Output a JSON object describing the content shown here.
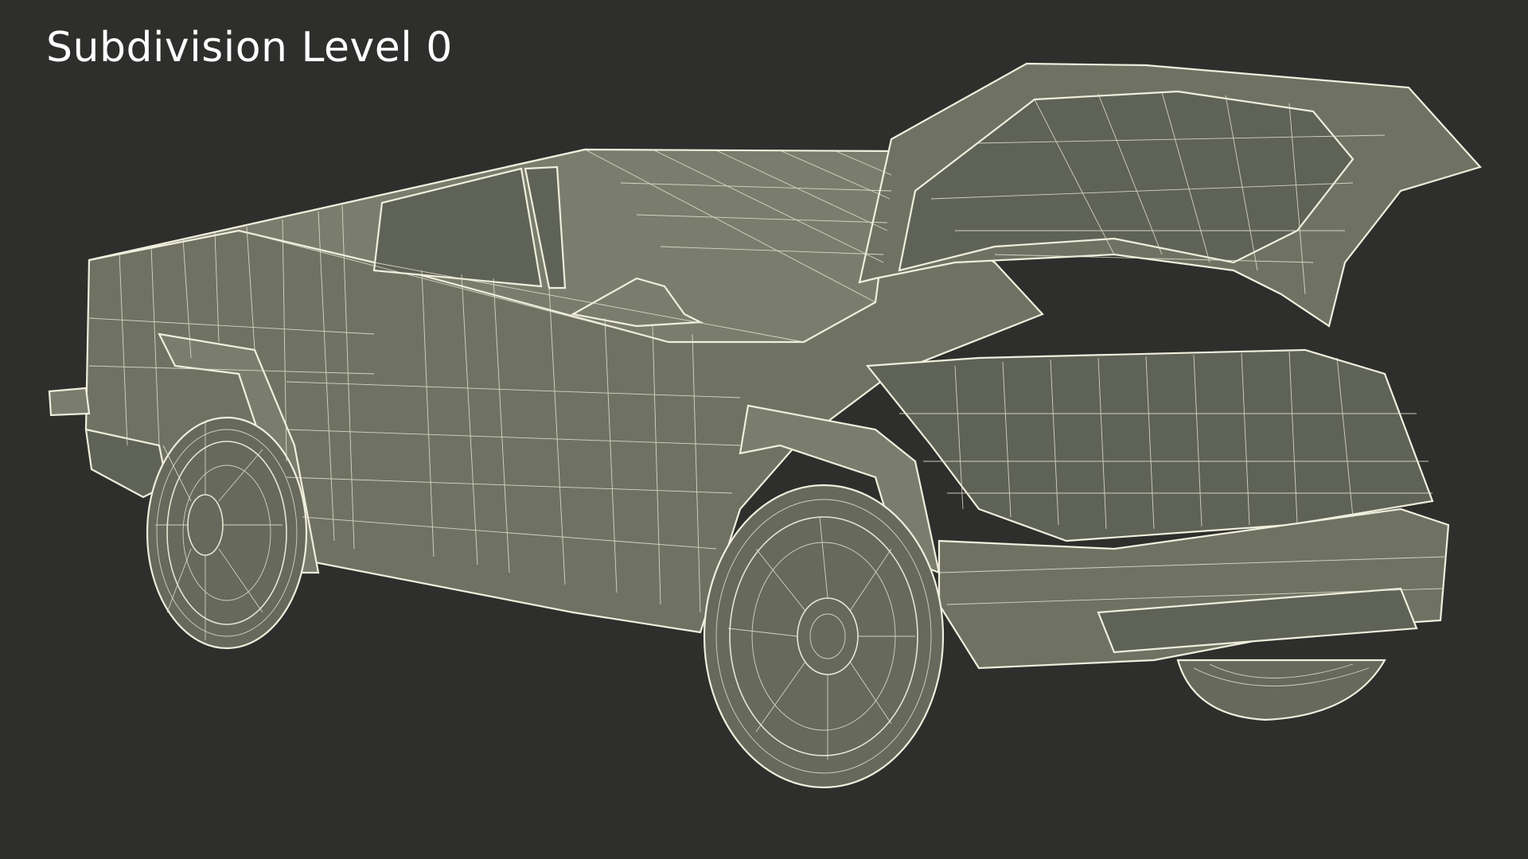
{
  "title": "Subdivision Level 0",
  "colors": {
    "background": "#2e2e2c",
    "surface": "#6f7263",
    "wireframe": "#f0eedd"
  }
}
